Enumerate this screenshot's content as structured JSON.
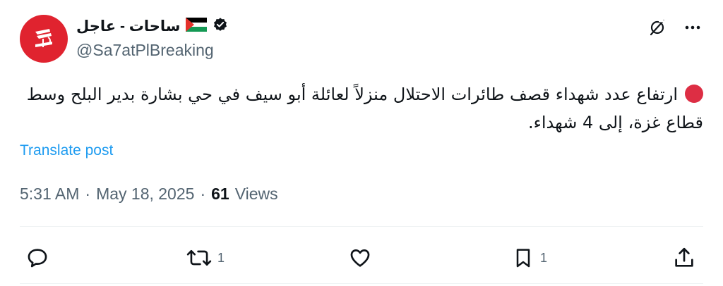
{
  "account": {
    "name": "ساحات - عاجل",
    "handle": "@Sa7atPlBreaking"
  },
  "icons": {
    "verified": "verified-badge-icon",
    "flag": "palestine-flag-icon",
    "grok": "grok-icon",
    "more": "more-icon",
    "reply": "reply-icon",
    "retweet": "retweet-icon",
    "like": "like-icon",
    "bookmark": "bookmark-icon",
    "share": "share-icon",
    "dot": "red-circle-emoji"
  },
  "post": {
    "text": "ارتفاع عدد شهداء قصف طائرات الاحتلال منزلاً لعائلة أبو سيف في حي بشارة بدير البلح وسط قطاع غزة، إلى 4 شهداء.",
    "translate_label": "Translate post",
    "time": "5:31 AM",
    "separator": "·",
    "date": "May 18, 2025",
    "views_count": "61",
    "views_label": "Views"
  },
  "actions": {
    "retweet_count": "1",
    "bookmark_count": "1"
  },
  "colors": {
    "brand_red": "#e0232f",
    "link_blue": "#1d9bf0",
    "muted": "#536471"
  }
}
